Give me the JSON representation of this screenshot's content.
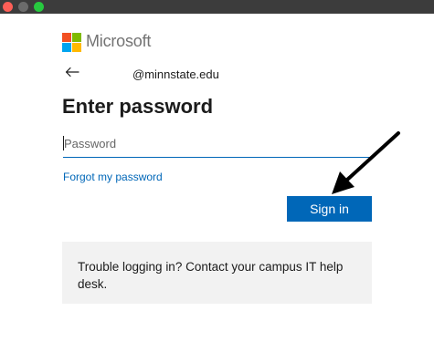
{
  "window": {
    "controls": [
      "close",
      "minimize",
      "zoom"
    ]
  },
  "logo": {
    "brand": "Microsoft",
    "colors": [
      "#f25022",
      "#7fba00",
      "#00a4ef",
      "#ffb900"
    ]
  },
  "identity": {
    "back_icon": "arrow-left-icon",
    "account": "@minnstate.edu"
  },
  "page": {
    "title": "Enter password"
  },
  "password": {
    "value": "",
    "placeholder": "Password"
  },
  "links": {
    "forgot": "Forgot my password"
  },
  "buttons": {
    "sign_in": "Sign in"
  },
  "help": {
    "text": "Trouble logging in? Contact your campus IT help desk."
  },
  "annotation": {
    "icon": "pointer-arrow-icon",
    "target": "Sign in"
  },
  "colors": {
    "accent": "#0067b8",
    "help_background": "#f2f2f2"
  }
}
